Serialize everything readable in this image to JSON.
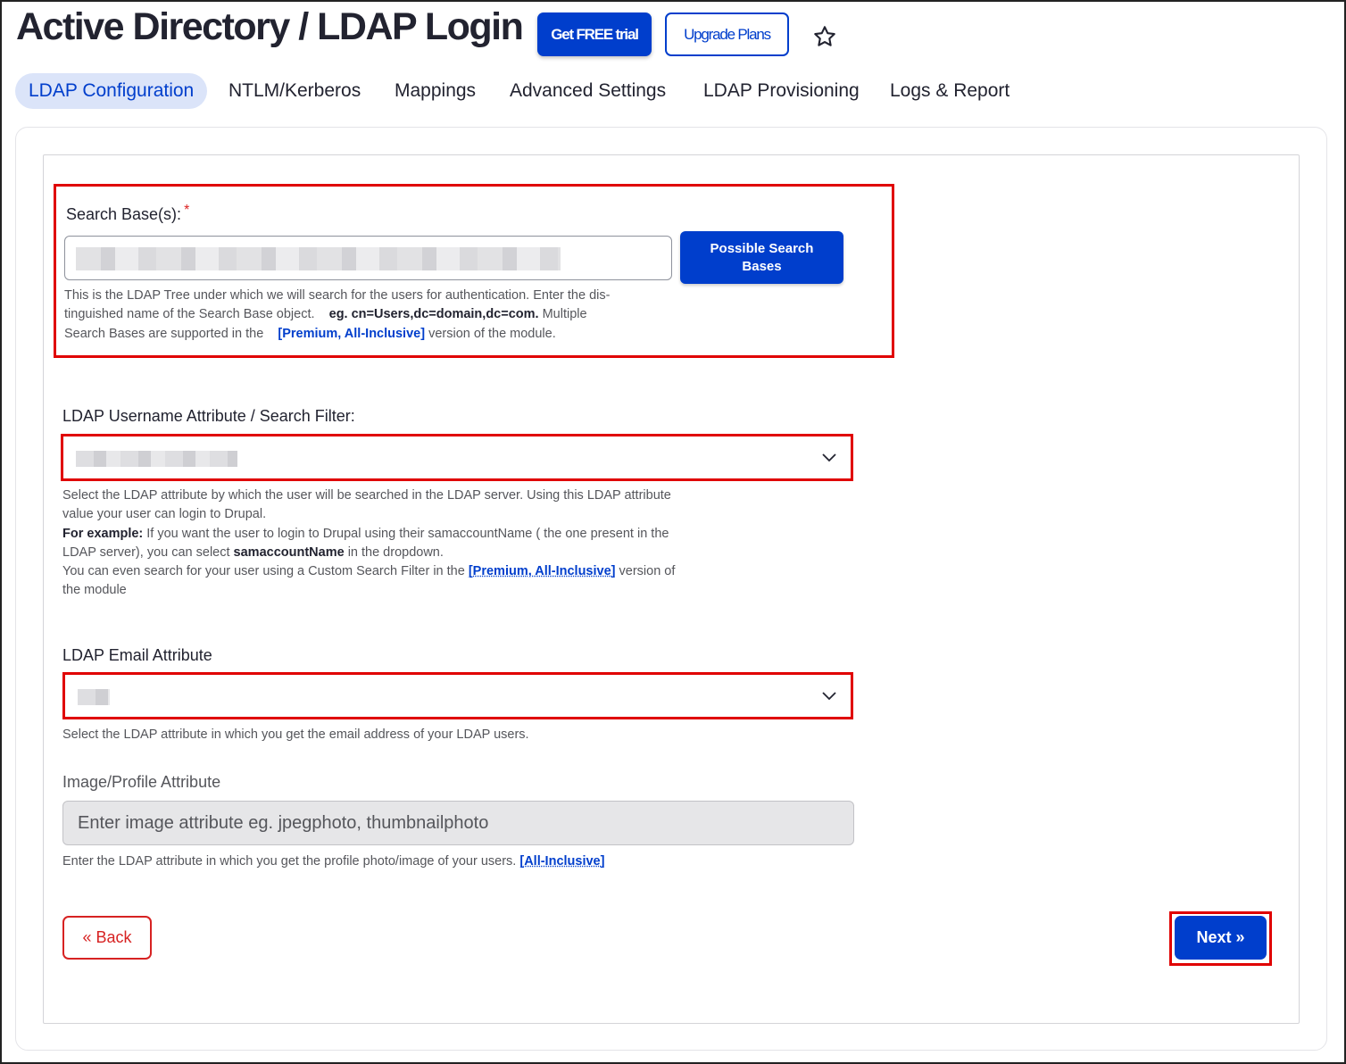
{
  "header": {
    "title": "Active Directory / LDAP Login",
    "free_trial_label": "Get FREE trial",
    "upgrade_label": "Upgrade Plans"
  },
  "tabs": [
    {
      "label": "LDAP Configuration",
      "active": true
    },
    {
      "label": "NTLM/Kerberos",
      "active": false
    },
    {
      "label": "Mappings",
      "active": false
    },
    {
      "label": "Advanced Settings",
      "active": false
    },
    {
      "label": "LDAP Provisioning",
      "active": false
    },
    {
      "label": "Logs & Report",
      "active": false
    }
  ],
  "search_base": {
    "label": "Search Base(s):",
    "required_mark": "*",
    "button_label": "Possible Search Bases",
    "help_line1": "This is the LDAP Tree under which we will search for the users for authentication. Enter the dis-",
    "help_line2_prefix": "tinguished name of the Search Base object.",
    "help_example": "eg. cn=Users,dc=domain,dc=com.",
    "help_line2_suffix": "Multiple",
    "help_line3_prefix": "Search Bases are supported in the",
    "help_link": "[Premium, All-Inclusive]",
    "help_line3_suffix": "version of the module."
  },
  "username_attr": {
    "label": "LDAP Username Attribute / Search Filter:",
    "help_line1": "Select the LDAP attribute by which the user will be searched in the LDAP server. Using this LDAP attribute",
    "help_line2": "value your user can login to Drupal.",
    "help_example_label": "For example:",
    "help_line3": "If you want the user to login to Drupal using their samaccountName ( the one present in the",
    "help_line4_prefix": "LDAP server), you can select",
    "help_line4_bold": "samaccountName",
    "help_line4_suffix": "in the dropdown.",
    "help_line5_prefix": "You can even search for your user using a Custom Search Filter in the",
    "help_link": "[Premium, All-Inclusive]",
    "help_line5_suffix": "version of",
    "help_line6": "the module"
  },
  "email_attr": {
    "label": "LDAP Email Attribute",
    "help": "Select the LDAP attribute in which you get the email address of your LDAP users."
  },
  "image_attr": {
    "label": "Image/Profile Attribute",
    "placeholder": "Enter image attribute eg. jpegphoto, thumbnailphoto",
    "help_prefix": "Enter the LDAP attribute in which you get the profile photo/image of your users.",
    "help_link": "[All-Inclusive]"
  },
  "nav": {
    "back_label": "« Back",
    "next_label": "Next »"
  },
  "colors": {
    "primary": "#003ecc",
    "highlight_red": "#e00000",
    "back_red": "#d72222"
  }
}
